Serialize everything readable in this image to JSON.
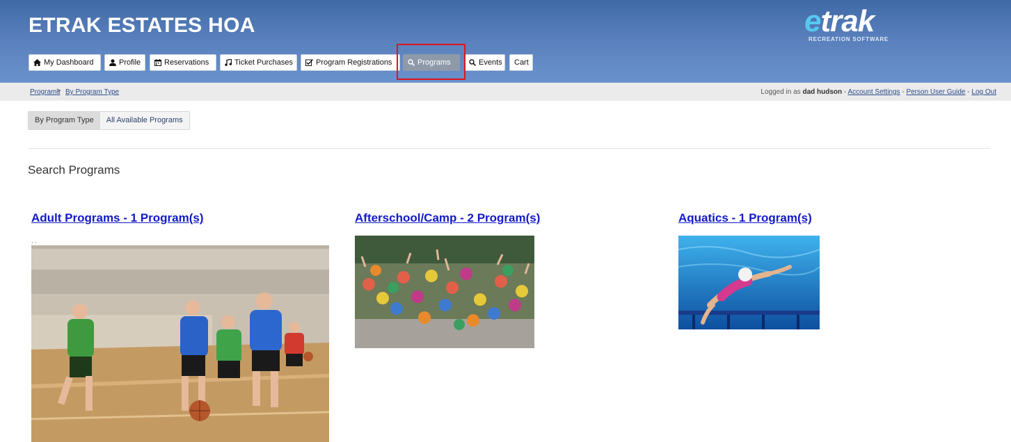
{
  "header": {
    "title": "ETRAK ESTATES HOA",
    "logo_text": "trak",
    "logo_e": "e",
    "logo_subtitle": "RECREATION SOFTWARE"
  },
  "nav": {
    "items": [
      {
        "label": "My Dashboard",
        "icon": "home-icon"
      },
      {
        "label": "Profile",
        "icon": "user-icon"
      },
      {
        "label": "Reservations",
        "icon": "calendar-icon"
      },
      {
        "label": "Ticket Purchases",
        "icon": "music-icon"
      },
      {
        "label": "Program Registrations",
        "icon": "checkbox-icon"
      },
      {
        "label": "Programs",
        "icon": "search-icon",
        "active": true
      },
      {
        "label": "Events",
        "icon": "search-icon"
      },
      {
        "label": "Cart",
        "icon": ""
      }
    ]
  },
  "breadcrumb": [
    "Programs",
    "By Program Type"
  ],
  "breadcrumb_sep": ">",
  "user": {
    "prefix": "Logged in as",
    "name": "dad hudson",
    "sep": "-",
    "account_settings": "Account Settings",
    "guide": "Person User Guide",
    "logout": "Log Out"
  },
  "tabs": [
    {
      "label": "By Program Type",
      "active": true
    },
    {
      "label": "All Available Programs",
      "active": false
    }
  ],
  "search_title": "Search Programs",
  "programs": [
    {
      "title": "Adult Programs - 1 Program(s)",
      "image": "basketball-kids-photo"
    },
    {
      "title": "Afterschool/Camp - 2 Program(s)",
      "image": "camp-group-photo"
    },
    {
      "title": "Aquatics - 1 Program(s)",
      "image": "swimmer-photo"
    }
  ],
  "dots": ", ,"
}
